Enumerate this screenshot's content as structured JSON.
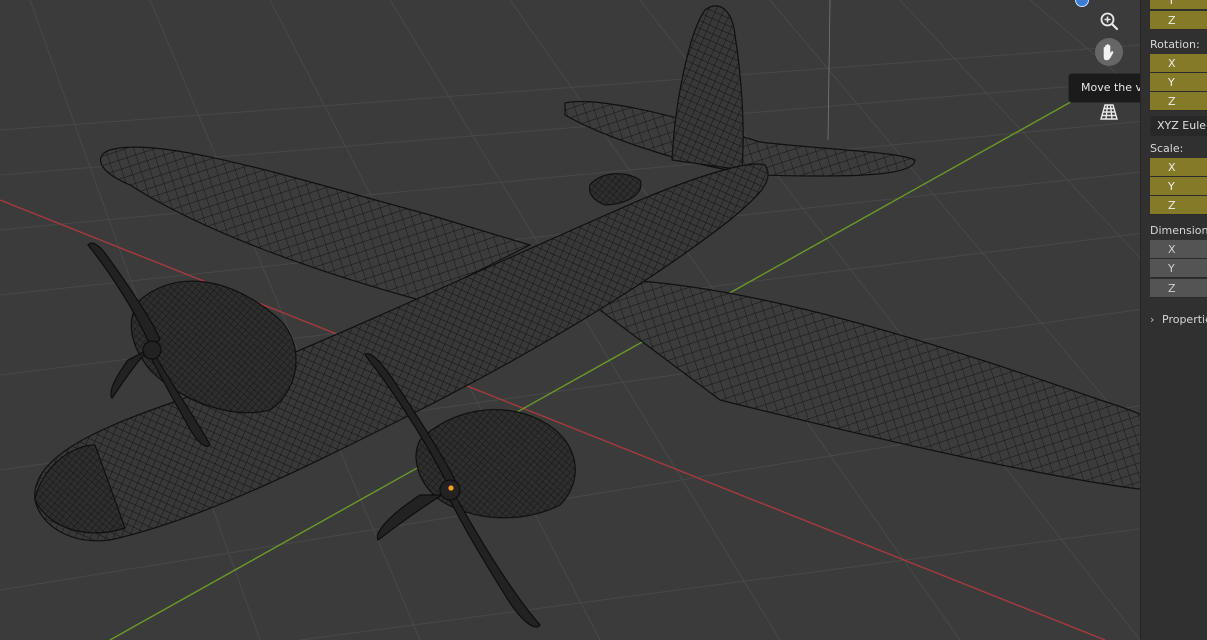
{
  "viewport": {
    "gizmo_buttons": [
      {
        "icon": "zoom-plus-icon"
      },
      {
        "icon": "hand-icon"
      },
      {
        "icon": "perspective-grid-icon"
      }
    ],
    "tooltip": "Move the view",
    "colors": {
      "background": "#3b3b3b",
      "grid": "#4a4a4a",
      "x_axis": "#a63a3e",
      "y_axis": "#6b9a28",
      "wire": "#121212",
      "origin": "#ff9a1f",
      "active_indicator": "#3d7bd6"
    }
  },
  "panel": {
    "top_field": {
      "axis": "Y"
    },
    "location_z": {
      "axis": "Z",
      "value": "("
    },
    "rotation": {
      "label": "Rotation:",
      "fields": [
        {
          "axis": "X"
        },
        {
          "axis": "Y"
        },
        {
          "axis": "Z"
        }
      ],
      "mode": "XYZ Euler"
    },
    "scale": {
      "label": "Scale:",
      "fields": [
        {
          "axis": "X"
        },
        {
          "axis": "Y"
        },
        {
          "axis": "Z"
        }
      ]
    },
    "dimensions": {
      "label": "Dimensions:",
      "fields": [
        {
          "axis": "X"
        },
        {
          "axis": "Y"
        },
        {
          "axis": "Z"
        }
      ]
    },
    "properties_label": "Properties",
    "colors": {
      "animated_field": "#857a28",
      "plain_field": "#545454",
      "panel_bg": "#303030"
    }
  }
}
